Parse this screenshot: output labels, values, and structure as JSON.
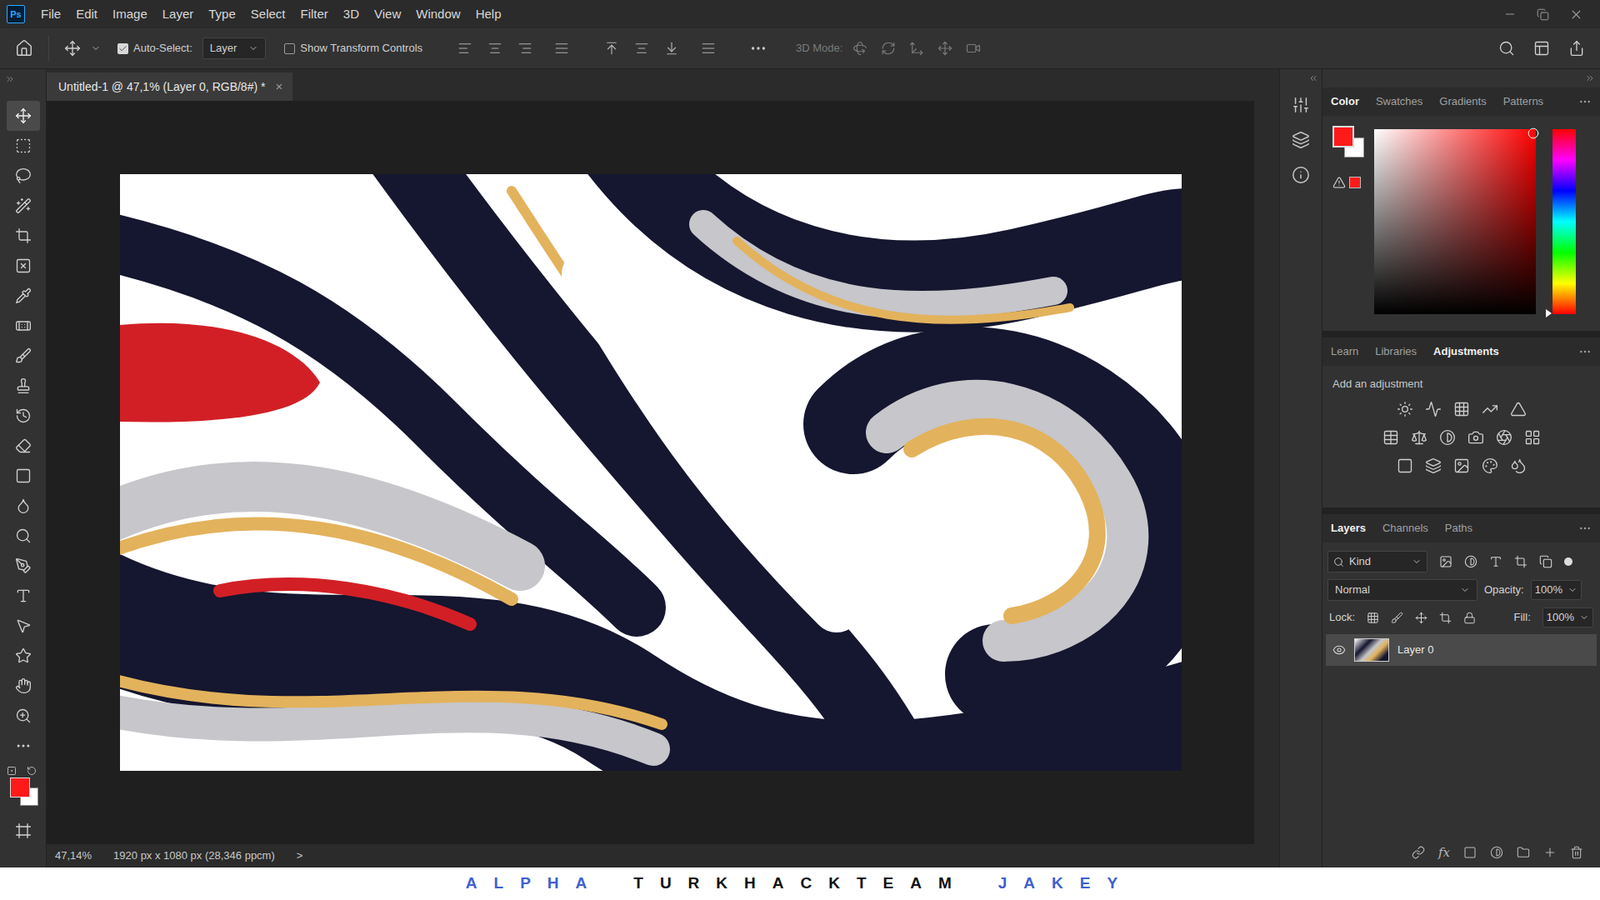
{
  "app": {
    "logo": "Ps"
  },
  "menu": [
    "File",
    "Edit",
    "Image",
    "Layer",
    "Type",
    "Select",
    "Filter",
    "3D",
    "View",
    "Window",
    "Help"
  ],
  "options_bar": {
    "auto_select": {
      "label": "Auto-Select:",
      "checked": true
    },
    "target": "Layer",
    "show_transform_controls": {
      "label": "Show Transform Controls",
      "checked": false
    },
    "mode_3d": "3D Mode:"
  },
  "document_tab": {
    "title": "Untitled-1 @ 47,1% (Layer 0, RGB/8#) *",
    "close": "×"
  },
  "tools": [
    {
      "selected": true
    },
    {
      "selected": false
    },
    {
      "selected": false
    },
    {
      "selected": false
    },
    {
      "selected": false
    },
    {
      "selected": false
    },
    {
      "selected": false
    },
    {
      "selected": false
    },
    {
      "selected": false
    },
    {
      "selected": false
    },
    {
      "selected": false
    },
    {
      "selected": false
    },
    {
      "selected": false
    },
    {
      "selected": false
    },
    {
      "selected": false
    },
    {
      "selected": false
    },
    {
      "selected": false
    },
    {
      "selected": false
    },
    {
      "selected": false
    },
    {
      "selected": false
    },
    {
      "selected": false
    }
  ],
  "colors": {
    "foreground": "#ff1a1a",
    "background": "#ffffff"
  },
  "status_bar": {
    "zoom": "47,14%",
    "info": "1920 px x 1080 px (28,346 ppcm)",
    "arrow": ">"
  },
  "color_panel": {
    "tabs": [
      {
        "label": "Color",
        "selected": true
      },
      {
        "label": "Swatches",
        "selected": false
      },
      {
        "label": "Gradients",
        "selected": false
      },
      {
        "label": "Patterns",
        "selected": false
      }
    ]
  },
  "adjustments_panel": {
    "tabs": [
      {
        "label": "Learn",
        "selected": false
      },
      {
        "label": "Libraries",
        "selected": false
      },
      {
        "label": "Adjustments",
        "selected": true
      }
    ],
    "hint": "Add an adjustment"
  },
  "layers_panel": {
    "tabs": [
      {
        "label": "Layers",
        "selected": true
      },
      {
        "label": "Channels",
        "selected": false
      },
      {
        "label": "Paths",
        "selected": false
      }
    ],
    "filter": "Kind",
    "blend_mode": "Normal",
    "opacity_label": "Opacity:",
    "opacity": "100%",
    "lock_label": "Lock:",
    "fill_label": "Fill:",
    "fill": "100%",
    "fx": "fx",
    "layers": [
      {
        "name": "Layer 0",
        "visible": true,
        "selected": true
      }
    ]
  },
  "watermark": [
    {
      "text": "ALPHA",
      "color": "#3f5fd0"
    },
    {
      "text": "TURKHACKTEAM",
      "color": "#111111"
    },
    {
      "text": "JAKEY",
      "color": "#3f5fd0"
    }
  ]
}
